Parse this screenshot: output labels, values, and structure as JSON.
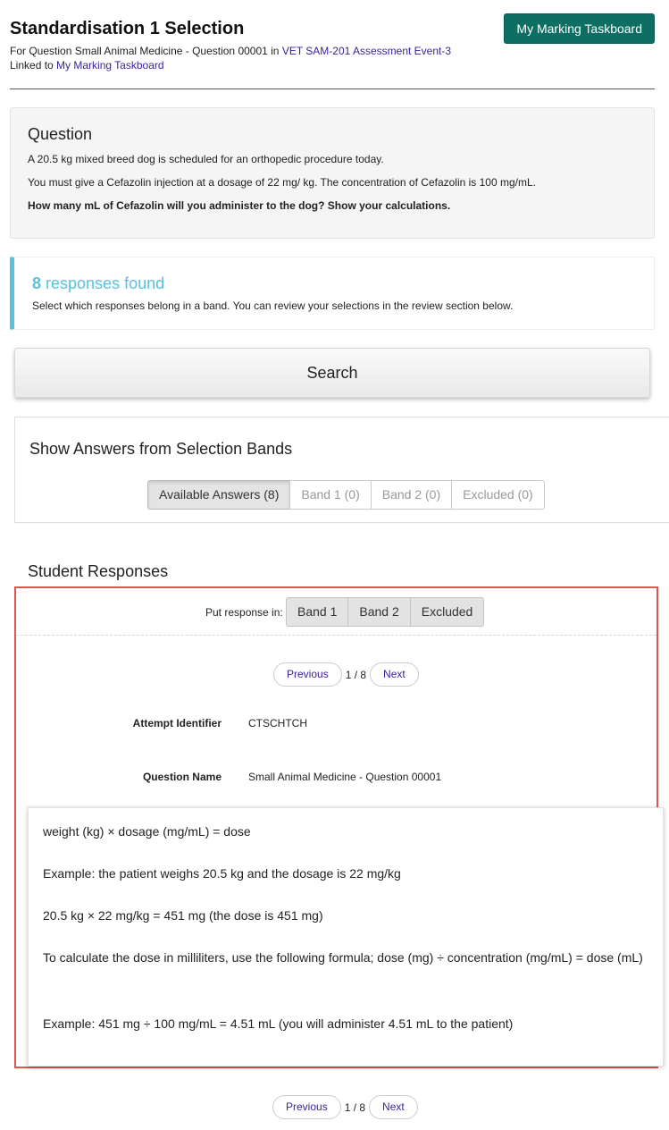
{
  "header": {
    "title": "Standardisation 1 Selection",
    "for_prefix": "For Question Small Animal Medicine - Question 00001 in ",
    "event_link": "VET SAM-201 Assessment Event-3",
    "linked_prefix": "Linked to ",
    "taskboard_link": "My Marking Taskboard",
    "taskboard_button": "My Marking Taskboard"
  },
  "question": {
    "heading": "Question",
    "lines": [
      "A 20.5 kg mixed breed dog is scheduled for an orthopedic procedure today.",
      "You must give a Cefazolin injection at a dosage of 22 mg/ kg. The concentration of Cefazolin is 100 mg/mL.",
      "How many mL of Cefazolin will you administer to the dog? Show your calculations."
    ]
  },
  "responses_found": {
    "count": "8",
    "title_suffix": " responses found",
    "description": "Select which responses belong in a band. You can review your selections in the review section below."
  },
  "search": {
    "label": "Search"
  },
  "bands": {
    "heading": "Show Answers from Selection Bands",
    "tabs": [
      {
        "label": "Available Answers (8)",
        "active": true
      },
      {
        "label": "Band 1 (0)",
        "active": false
      },
      {
        "label": "Band 2 (0)",
        "active": false
      },
      {
        "label": "Excluded (0)",
        "active": false
      }
    ]
  },
  "student_responses": {
    "heading": "Student Responses",
    "put_label": "Put response in:",
    "put_buttons": [
      "Band 1",
      "Band 2",
      "Excluded"
    ],
    "pager": {
      "previous": "Previous",
      "count": "1 / 8",
      "next": "Next"
    },
    "attempt_label": "Attempt Identifier",
    "attempt_value": "CTSCHTCH",
    "question_name_label": "Question Name",
    "question_name_value": "Small Animal Medicine - Question 00001",
    "answer": [
      "weight (kg) × dosage (mg/mL) = dose",
      "Example: the patient weighs 20.5 kg and the dosage is 22 mg/kg",
      "20.5 kg × 22 mg/kg = 451 mg (the dose is 451 mg)",
      "To calculate the dose in milliliters, use the following formula; dose (mg) ÷ concentration (mg/mL) = dose (mL)",
      "Example: 451 mg ÷ 100 mg/mL = 4.51 mL (you will administer 4.51 mL to the patient)"
    ]
  },
  "colors": {
    "primary_button": "#0d6e63",
    "link": "#3a1f9c",
    "info_accent": "#5bc0de",
    "highlight_border": "#e05550"
  }
}
